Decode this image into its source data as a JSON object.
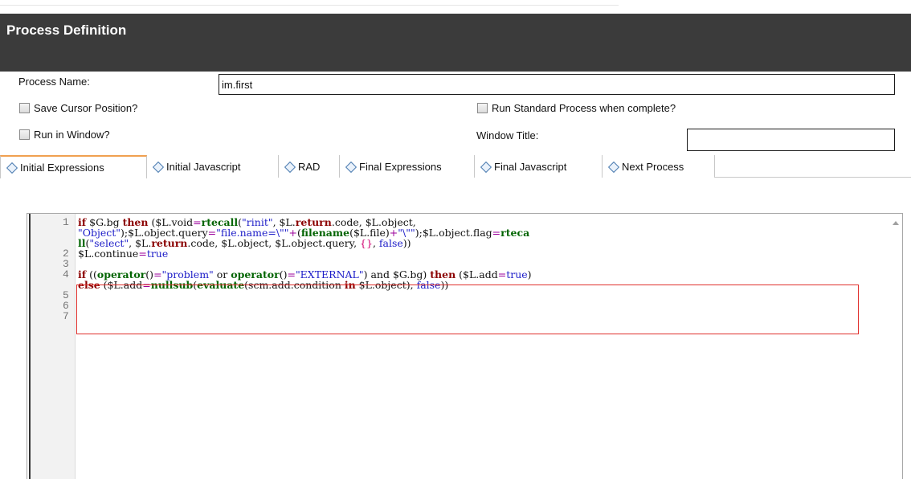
{
  "header": {
    "title": "Process Definition"
  },
  "form": {
    "process_name_label": "Process Name:",
    "process_name_value": "im.first",
    "save_cursor_label": "Save Cursor Position?",
    "run_standard_label": "Run Standard Process when complete?",
    "run_window_label": "Run in Window?",
    "window_title_label": "Window Title:",
    "window_title_value": ""
  },
  "tabs": [
    {
      "label": "Initial Expressions",
      "active": true
    },
    {
      "label": "Initial Javascript",
      "active": false
    },
    {
      "label": "RAD",
      "active": false
    },
    {
      "label": "Final Expressions",
      "active": false
    },
    {
      "label": "Final Javascript",
      "active": false
    },
    {
      "label": "Next Process",
      "active": false
    }
  ],
  "editor": {
    "line_numbers": [
      "1",
      "2",
      "3",
      "4",
      "5",
      "6",
      "7"
    ],
    "lines": [
      [
        [
          "kw",
          "if"
        ],
        [
          "t",
          " $G.bg "
        ],
        [
          "kw",
          "then"
        ],
        [
          "t",
          " ($L.void"
        ],
        [
          "eq",
          "="
        ],
        [
          "fn",
          "rtecall"
        ],
        [
          "t",
          "("
        ],
        [
          "str",
          "\"rinit\""
        ],
        [
          "t",
          ", $L."
        ],
        [
          "kw",
          "return"
        ],
        [
          "t",
          ".code, $L.object,"
        ]
      ],
      [
        [
          "str",
          "\"Object\""
        ],
        [
          "t",
          ");$L.object.query"
        ],
        [
          "eq",
          "="
        ],
        [
          "str",
          "\"file.name=\\\"\""
        ],
        [
          "eq",
          "+"
        ],
        [
          "t",
          "("
        ],
        [
          "fn",
          "filename"
        ],
        [
          "t",
          "($L.file)"
        ],
        [
          "eq",
          "+"
        ],
        [
          "str",
          "\"\\\"\""
        ],
        [
          "t",
          ");$L.object.flag"
        ],
        [
          "eq",
          "="
        ],
        [
          "fn",
          "rteca"
        ]
      ],
      [
        [
          "fn",
          "ll"
        ],
        [
          "t",
          "("
        ],
        [
          "str",
          "\"select\""
        ],
        [
          "t",
          ", $L."
        ],
        [
          "kw",
          "return"
        ],
        [
          "t",
          ".code, $L.object, $L.object.query, "
        ],
        [
          "brace",
          "{}"
        ],
        [
          "t",
          ", "
        ],
        [
          "val",
          "false"
        ],
        [
          "t",
          "))"
        ]
      ],
      [
        [
          "t",
          "$L.continue"
        ],
        [
          "eq",
          "="
        ],
        [
          "val",
          "true"
        ]
      ],
      [],
      [
        [
          "kw",
          "if"
        ],
        [
          "t",
          " (("
        ],
        [
          "fn",
          "operator"
        ],
        [
          "t",
          "()"
        ],
        [
          "eq",
          "="
        ],
        [
          "str",
          "\"problem\""
        ],
        [
          "t",
          " or "
        ],
        [
          "fn",
          "operator"
        ],
        [
          "t",
          "()"
        ],
        [
          "eq",
          "="
        ],
        [
          "str",
          "\"EXTERNAL\""
        ],
        [
          "t",
          ") and $G.bg) "
        ],
        [
          "kw",
          "then"
        ],
        [
          "t",
          " ($L.add"
        ],
        [
          "eq",
          "="
        ],
        [
          "val",
          "true"
        ],
        [
          "t",
          ")"
        ]
      ],
      [
        [
          "kw",
          "else"
        ],
        [
          "t",
          " ($L.add"
        ],
        [
          "eq",
          "="
        ],
        [
          "fn",
          "nullsub"
        ],
        [
          "t",
          "("
        ],
        [
          "fn",
          "evaluate"
        ],
        [
          "t",
          "(scm.add.condition "
        ],
        [
          "kw",
          "in"
        ],
        [
          "t",
          " $L.object), "
        ],
        [
          "val",
          "false"
        ],
        [
          "t",
          "))"
        ]
      ]
    ]
  },
  "colors": {
    "header_bg": "#3b3b3b",
    "active_tab_accent": "#f0a050",
    "highlight_border": "#e0302c",
    "keyword": "#8b0000",
    "function": "#006400",
    "string": "#1c1cc8"
  },
  "icons": {
    "tab_icon": "diamond-icon",
    "scroll": "scroll-up-arrow-icon"
  }
}
